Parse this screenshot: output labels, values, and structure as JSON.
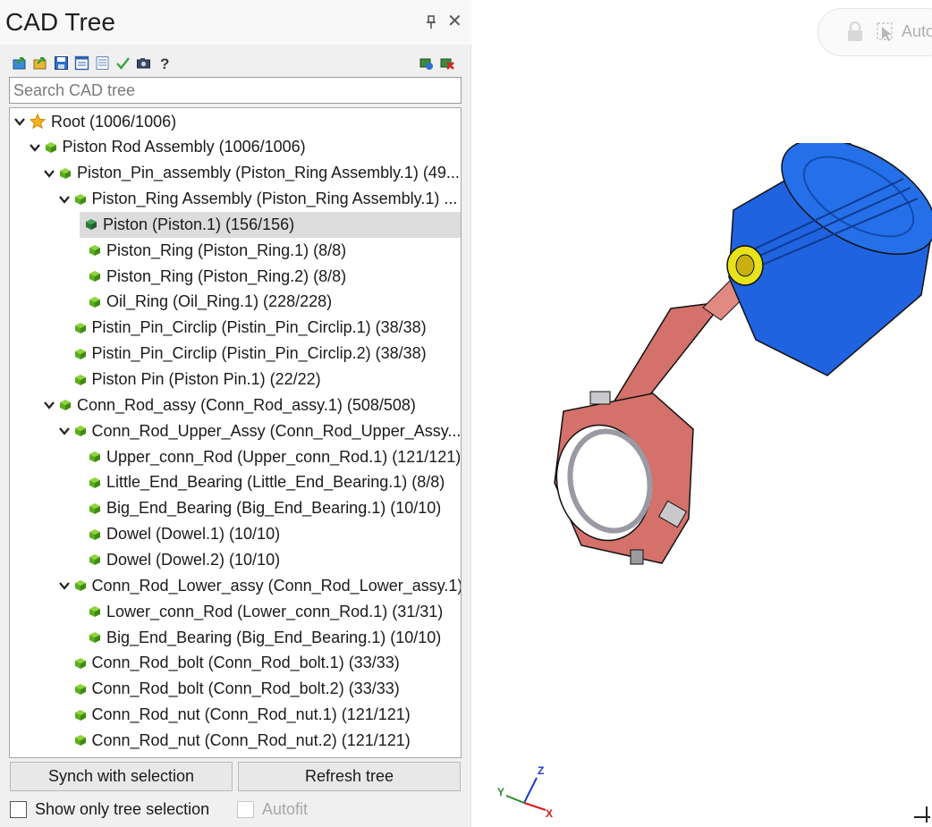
{
  "panel": {
    "title": "CAD Tree",
    "search_placeholder": "Search CAD tree",
    "toolbar_icons": [
      "import-icon",
      "export-icon",
      "save-icon",
      "properties-icon",
      "list-icon",
      "check-icon",
      "camera-icon",
      "help-icon"
    ],
    "toolbar_right_icons": [
      "add-part-icon",
      "delete-part-icon"
    ],
    "buttons": {
      "sync": "Synch with selection",
      "refresh": "Refresh tree"
    },
    "checkboxes": {
      "show_only": {
        "label": "Show only tree selection",
        "checked": false
      },
      "autofit": {
        "label": "Autofit",
        "checked": false,
        "disabled": true
      }
    }
  },
  "tree": [
    {
      "label": "Root (1006/1006)",
      "depth": 0,
      "expanded": true,
      "icon": "star"
    },
    {
      "label": "Piston Rod Assembly (1006/1006)",
      "depth": 1,
      "expanded": true,
      "icon": "cube"
    },
    {
      "label": "Piston_Pin_assembly (Piston_Ring Assembly.1) (49...",
      "depth": 2,
      "expanded": true,
      "icon": "cube"
    },
    {
      "label": "Piston_Ring Assembly (Piston_Ring Assembly.1) ...",
      "depth": 3,
      "expanded": true,
      "icon": "cube"
    },
    {
      "label": "Piston (Piston.1) (156/156)",
      "depth": 4,
      "icon": "cube-dark",
      "selected": true
    },
    {
      "label": "Piston_Ring (Piston_Ring.1) (8/8)",
      "depth": 4,
      "icon": "cube"
    },
    {
      "label": "Piston_Ring (Piston_Ring.2) (8/8)",
      "depth": 4,
      "icon": "cube"
    },
    {
      "label": "Oil_Ring (Oil_Ring.1) (228/228)",
      "depth": 4,
      "icon": "cube"
    },
    {
      "label": "Pistin_Pin_Circlip (Pistin_Pin_Circlip.1) (38/38)",
      "depth": 3,
      "icon": "cube"
    },
    {
      "label": "Pistin_Pin_Circlip (Pistin_Pin_Circlip.2) (38/38)",
      "depth": 3,
      "icon": "cube"
    },
    {
      "label": "Piston Pin (Piston Pin.1) (22/22)",
      "depth": 3,
      "icon": "cube"
    },
    {
      "label": "Conn_Rod_assy (Conn_Rod_assy.1) (508/508)",
      "depth": 2,
      "expanded": true,
      "icon": "cube"
    },
    {
      "label": "Conn_Rod_Upper_Assy (Conn_Rod_Upper_Assy....",
      "depth": 3,
      "expanded": true,
      "icon": "cube"
    },
    {
      "label": "Upper_conn_Rod (Upper_conn_Rod.1) (121/121)",
      "depth": 4,
      "icon": "cube"
    },
    {
      "label": "Little_End_Bearing (Little_End_Bearing.1) (8/8)",
      "depth": 4,
      "icon": "cube"
    },
    {
      "label": "Big_End_Bearing (Big_End_Bearing.1) (10/10)",
      "depth": 4,
      "icon": "cube"
    },
    {
      "label": "Dowel (Dowel.1) (10/10)",
      "depth": 4,
      "icon": "cube"
    },
    {
      "label": "Dowel (Dowel.2) (10/10)",
      "depth": 4,
      "icon": "cube"
    },
    {
      "label": "Conn_Rod_Lower_assy (Conn_Rod_Lower_assy.1)...",
      "depth": 3,
      "expanded": true,
      "icon": "cube"
    },
    {
      "label": "Lower_conn_Rod (Lower_conn_Rod.1) (31/31)",
      "depth": 4,
      "icon": "cube"
    },
    {
      "label": "Big_End_Bearing (Big_End_Bearing.1) (10/10)",
      "depth": 4,
      "icon": "cube"
    },
    {
      "label": "Conn_Rod_bolt (Conn_Rod_bolt.1) (33/33)",
      "depth": 3,
      "icon": "cube"
    },
    {
      "label": "Conn_Rod_bolt (Conn_Rod_bolt.2) (33/33)",
      "depth": 3,
      "icon": "cube"
    },
    {
      "label": "Conn_Rod_nut (Conn_Rod_nut.1) (121/121)",
      "depth": 3,
      "icon": "cube"
    },
    {
      "label": "Conn_Rod_nut (Conn_Rod_nut.2) (121/121)",
      "depth": 3,
      "icon": "cube"
    }
  ],
  "viewport": {
    "auto_button_label": "Autofit",
    "triad": {
      "x": "X",
      "y": "Y",
      "z": "Z"
    },
    "colors": {
      "piston": "#1f63e0",
      "rod": "#d97a72",
      "pin": "#e7e21a",
      "selection": "#dcdcdc"
    }
  }
}
